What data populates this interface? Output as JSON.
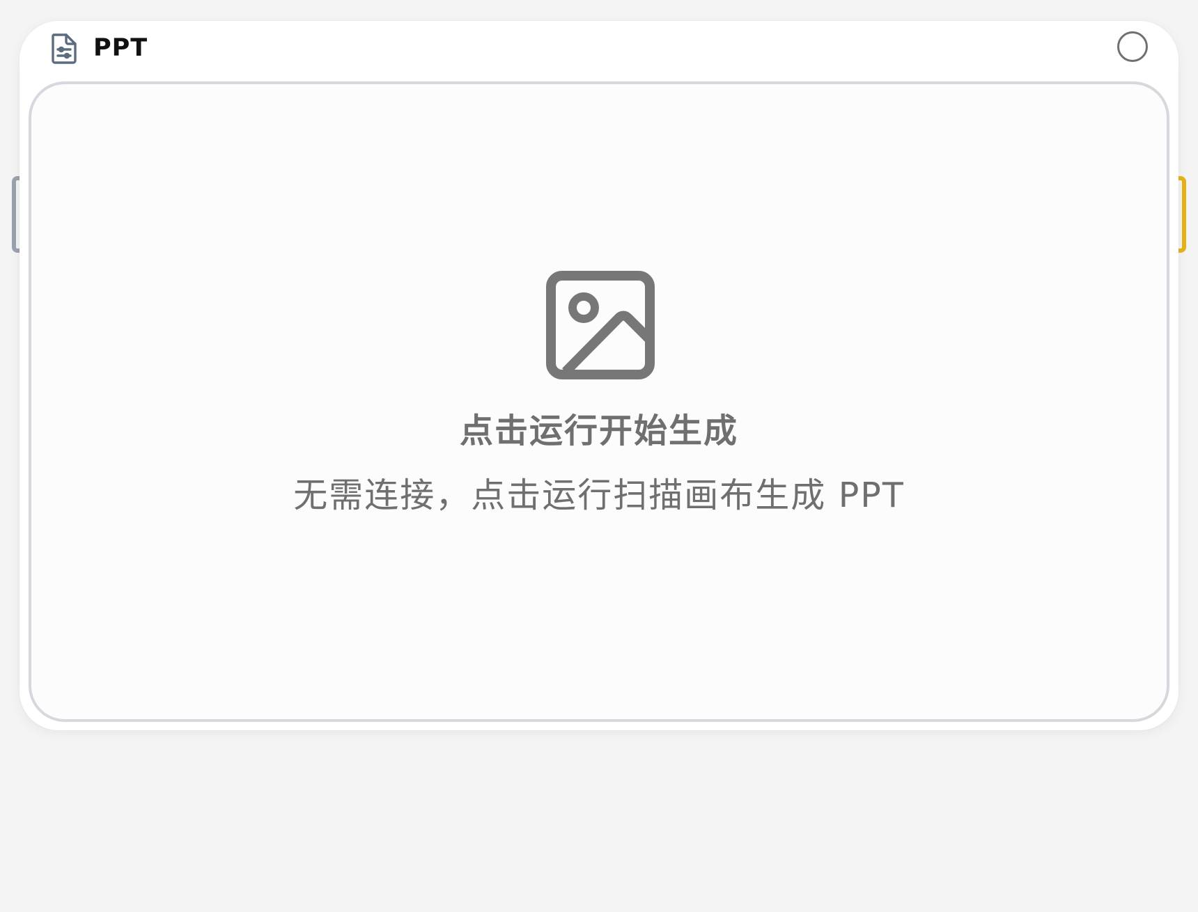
{
  "node": {
    "title": "PPT",
    "header_icon": "document-settings-icon",
    "status_icon": "status-circle-icon"
  },
  "placeholder": {
    "icon": "image-icon",
    "primary_text": "点击运行开始生成",
    "secondary_text": "无需连接，点击运行扫描画布生成 PPT"
  },
  "handles": {
    "input_color": "#9aa2ae",
    "output_color": "#e7b416"
  },
  "colors": {
    "background": "#f4f4f4",
    "card": "#ffffff",
    "preview_border": "#d6d8dd",
    "icon_gray": "#777777",
    "header_icon": "#5d6b80"
  }
}
